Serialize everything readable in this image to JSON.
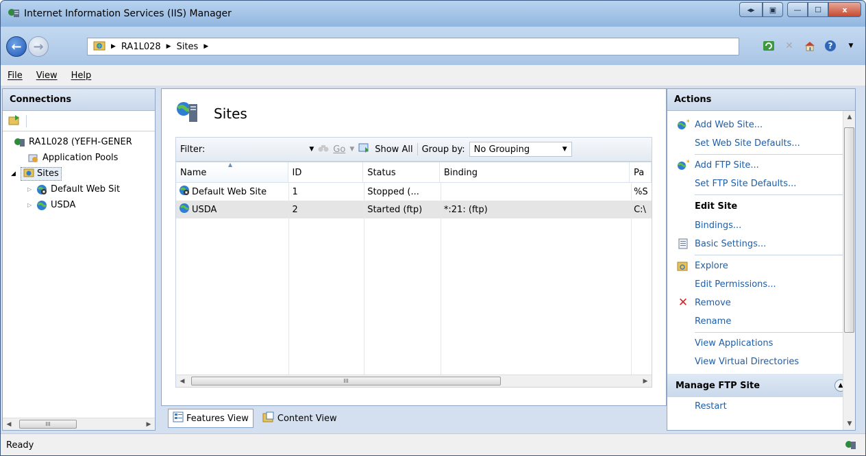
{
  "window": {
    "title": "Internet Information Services (IIS) Manager",
    "controls": [
      "◂▸",
      "▣",
      "—",
      "☐",
      "x"
    ]
  },
  "address": {
    "crumbs": [
      "RA1L028",
      "Sites"
    ]
  },
  "menu": {
    "file": "File",
    "view": "View",
    "help": "Help"
  },
  "connections": {
    "header": "Connections",
    "tree": {
      "server": "RA1L028 (YEFH-GENER",
      "app_pools": "Application Pools",
      "sites": "Sites",
      "default_site": "Default Web Sit",
      "usda": "USDA"
    }
  },
  "center": {
    "title": "Sites",
    "filter_label": "Filter:",
    "go_label": "Go",
    "show_all_label": "Show All",
    "group_by_label": "Group by:",
    "group_by_value": "No Grouping",
    "columns": [
      "Name",
      "ID",
      "Status",
      "Binding",
      "Pa"
    ],
    "rows": [
      {
        "name": "Default Web Site",
        "id": "1",
        "status": "Stopped (...",
        "binding": "",
        "path": "%S"
      },
      {
        "name": "USDA",
        "id": "2",
        "status": "Started (ftp)",
        "binding": "*:21: (ftp)",
        "path": "C:\\"
      }
    ],
    "features_view": "Features View",
    "content_view": "Content View"
  },
  "actions": {
    "header": "Actions",
    "add_web_site": "Add Web Site...",
    "set_web_defaults": "Set Web Site Defaults...",
    "add_ftp_site": "Add FTP Site...",
    "set_ftp_defaults": "Set FTP Site Defaults...",
    "edit_site": "Edit Site",
    "bindings": "Bindings...",
    "basic_settings": "Basic Settings...",
    "explore": "Explore",
    "edit_permissions": "Edit Permissions...",
    "remove": "Remove",
    "rename": "Rename",
    "view_applications": "View Applications",
    "view_virtual_dirs": "View Virtual Directories",
    "manage_ftp": "Manage FTP Site",
    "restart": "Restart"
  },
  "status": {
    "text": "Ready"
  },
  "colors": {
    "link": "#1e5ea8",
    "remove_icon": "#d42020"
  }
}
